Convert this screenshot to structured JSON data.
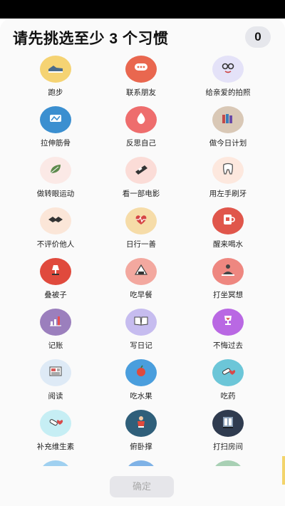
{
  "header": {
    "title": "请先挑选至少 3 个习惯",
    "selected_count": "0"
  },
  "habits": [
    {
      "label": "跑步",
      "icon": "sneaker-icon",
      "color": "#f5d373"
    },
    {
      "label": "联系朋友",
      "icon": "chat-bubble-icon",
      "color": "#e9674f"
    },
    {
      "label": "给亲爱的拍照",
      "icon": "glasses-face-icon",
      "color": "#e4e2f8"
    },
    {
      "label": "拉伸筋骨",
      "icon": "stretch-icon",
      "color": "#3b8fd0"
    },
    {
      "label": "反思自己",
      "icon": "water-drop-icon",
      "color": "#ee6d6d"
    },
    {
      "label": "做今日计划",
      "icon": "books-icon",
      "color": "#d9c8b6"
    },
    {
      "label": "做转眼运动",
      "icon": "leaf-icon",
      "color": "#fbe9e6"
    },
    {
      "label": "看一部电影",
      "icon": "film-strip-icon",
      "color": "#fbdcd7"
    },
    {
      "label": "用左手刷牙",
      "icon": "tooth-icon",
      "color": "#fde8de"
    },
    {
      "label": "不评价他人",
      "icon": "handshake-icon",
      "color": "#fbe6d8"
    },
    {
      "label": "日行一善",
      "icon": "heartbeat-icon",
      "color": "#f6dca8"
    },
    {
      "label": "醒来喝水",
      "icon": "cup-icon",
      "color": "#e0564b"
    },
    {
      "label": "叠被子",
      "icon": "lamp-icon",
      "color": "#e04a3d"
    },
    {
      "label": "吃早餐",
      "icon": "rice-ball-icon",
      "color": "#f3a89f"
    },
    {
      "label": "打坐冥想",
      "icon": "meditation-icon",
      "color": "#ee8780"
    },
    {
      "label": "记账",
      "icon": "bar-chart-icon",
      "color": "#9b7fbd"
    },
    {
      "label": "写日记",
      "icon": "open-book-icon",
      "color": "#c6bcef"
    },
    {
      "label": "不悔过去",
      "icon": "trophy-heart-icon",
      "color": "#b968e3"
    },
    {
      "label": "阅读",
      "icon": "newspaper-icon",
      "color": "#deeaf6"
    },
    {
      "label": "吃水果",
      "icon": "apple-icon",
      "color": "#4a9edd"
    },
    {
      "label": "吃药",
      "icon": "pill-heart-icon",
      "color": "#6cc6d8"
    },
    {
      "label": "补充维生素",
      "icon": "capsule-heart-icon",
      "color": "#c6eef4"
    },
    {
      "label": "俯卧撑",
      "icon": "pushup-icon",
      "color": "#2f5f7a"
    },
    {
      "label": "打扫房间",
      "icon": "cabinet-icon",
      "color": "#2f3b4f"
    }
  ],
  "partial_row_colors": [
    "#9fd0f0",
    "#7fb2e6",
    "#a8d0b4"
  ],
  "footer": {
    "confirm_label": "确定"
  }
}
